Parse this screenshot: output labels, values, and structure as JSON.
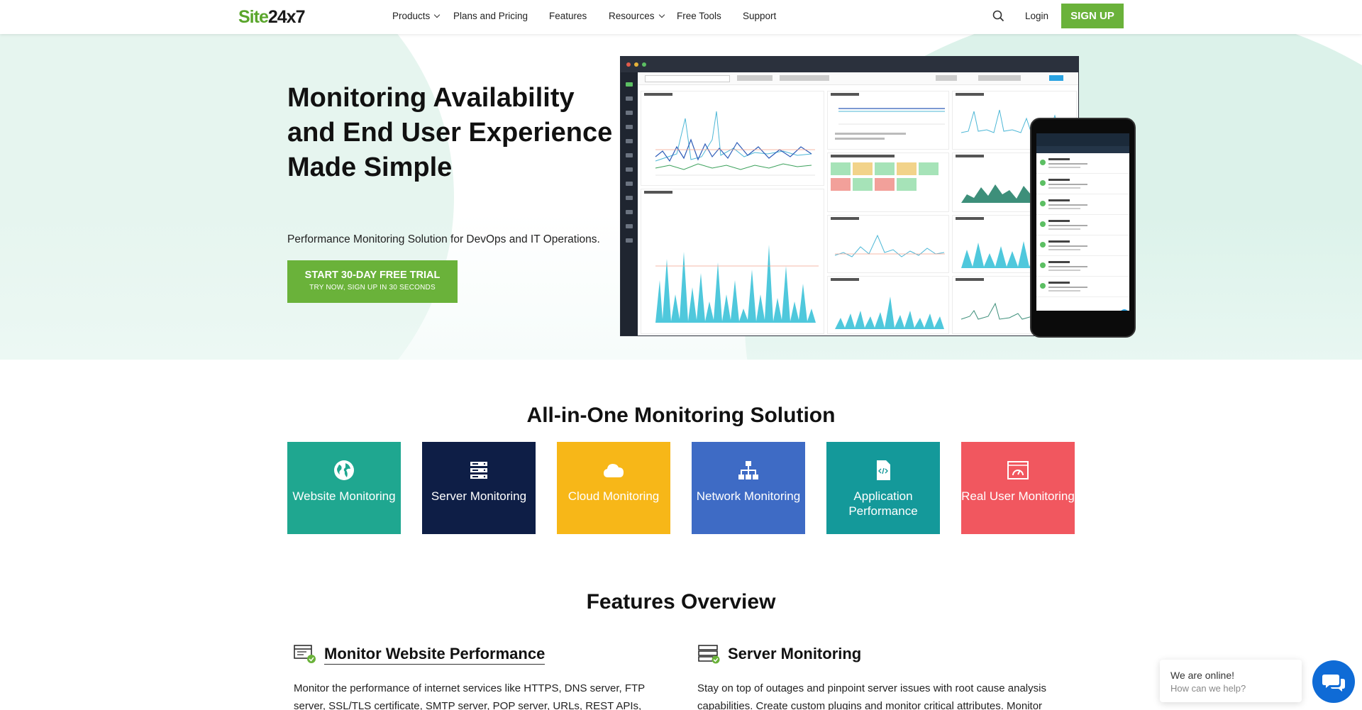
{
  "header": {
    "logo_site": "Site",
    "logo_num": "24x7",
    "nav": {
      "products": "Products",
      "plans": "Plans and Pricing",
      "features": "Features",
      "resources": "Resources",
      "tools": "Free Tools",
      "support": "Support"
    },
    "login": "Login",
    "signup": "SIGN UP"
  },
  "hero": {
    "title": "Monitoring Availability and End User Experience Made Simple",
    "subtitle": "Performance Monitoring Solution for DevOps and IT Operations.",
    "cta_main": "START 30-DAY FREE TRIAL",
    "cta_sub": "TRY NOW, SIGN UP IN 30 SECONDS"
  },
  "all_in_one": {
    "title": "All-in-One Monitoring Solution",
    "tiles": [
      {
        "label": "Website Monitoring",
        "color": "#1fa790",
        "icon": "globe-icon"
      },
      {
        "label": "Server Monitoring",
        "color": "#0e1e46",
        "icon": "server-icon"
      },
      {
        "label": "Cloud Monitoring",
        "color": "#f7b718",
        "icon": "cloud-icon"
      },
      {
        "label": "Network Monitoring",
        "color": "#3e6bc5",
        "icon": "network-icon"
      },
      {
        "label": "Application Performance",
        "color": "#14999a",
        "icon": "code-file-icon"
      },
      {
        "label": "Real User Monitoring",
        "color": "#f1575f",
        "icon": "speedometer-icon"
      }
    ]
  },
  "features": {
    "title": "Features Overview",
    "items": [
      {
        "title": "Monitor Website Performance",
        "text": "Monitor the performance of internet services like HTTPS, DNS server, FTP server, SSL/TLS certificate, SMTP server, POP server, URLs, REST APIs,",
        "icon": "browser-check-icon"
      },
      {
        "title": "Server Monitoring",
        "text": "Stay on top of outages and pinpoint server issues with root cause analysis capabilities. Create custom plugins and monitor critical attributes. Monitor",
        "icon": "server-check-icon"
      }
    ]
  },
  "chat": {
    "line1": "We are online!",
    "line2": "How can we help?",
    "icon": "chat-bubbles-icon"
  },
  "colors": {
    "brand_green": "#6ab23a",
    "logo_green": "#5aa62c"
  }
}
